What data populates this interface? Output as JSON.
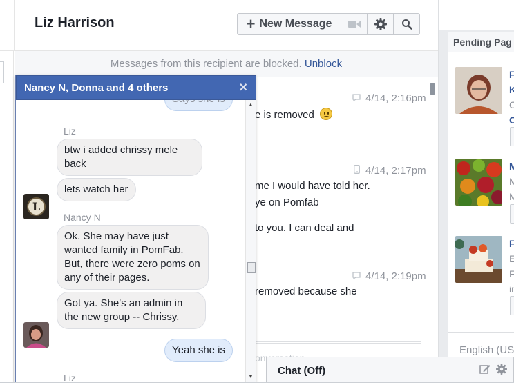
{
  "header": {
    "title": "Liz Harrison",
    "new_message_label": "New Message",
    "icons": [
      "video-camera-icon",
      "gear-icon",
      "search-icon"
    ]
  },
  "conversation": {
    "blocked_text": "Messages from this recipient are blocked.",
    "unblock_label": "Unblock",
    "timestamps": [
      "4/14, 2:16pm",
      "4/14, 2:17pm",
      "4/14, 2:19pm"
    ],
    "lines": [
      "e is removed",
      "me I would have told her.",
      "ye on Pomfab",
      "to you. I can deal and",
      "removed because she"
    ],
    "reply_placeholder": "onversation"
  },
  "chat_popup": {
    "title": "Nancy N, Donna and 4 others",
    "close_label": "×",
    "messages": [
      {
        "text": "Says she is",
        "mine": true
      },
      {
        "sender": "Liz"
      },
      {
        "text": "btw i added chrissy mele back"
      },
      {
        "text": "lets watch her"
      },
      {
        "sender": "Nancy N"
      },
      {
        "text": "Ok. She may have just wanted family in PomFab. But, there were zero poms on any of their pages."
      },
      {
        "text": "Got ya. She's an admin in the new group -- Chrissy."
      },
      {
        "text": "Yeah she is",
        "mine": true
      },
      {
        "sender": "Liz"
      }
    ],
    "avatar_initial": "L"
  },
  "right_panel": {
    "pending_title": "Pending Pag",
    "items": [
      {
        "line1": "F",
        "line2": "K",
        "line3": "C",
        "line4": "C"
      },
      {
        "line1": "M",
        "line2": "M",
        "line3": "M"
      },
      {
        "line1": "F",
        "line2": "E",
        "line3": "F",
        "line4": "in"
      }
    ],
    "language": "English (US"
  },
  "chatbar": {
    "label": "Chat (Off)",
    "icons": [
      "compose-icon",
      "gear-icon"
    ]
  }
}
